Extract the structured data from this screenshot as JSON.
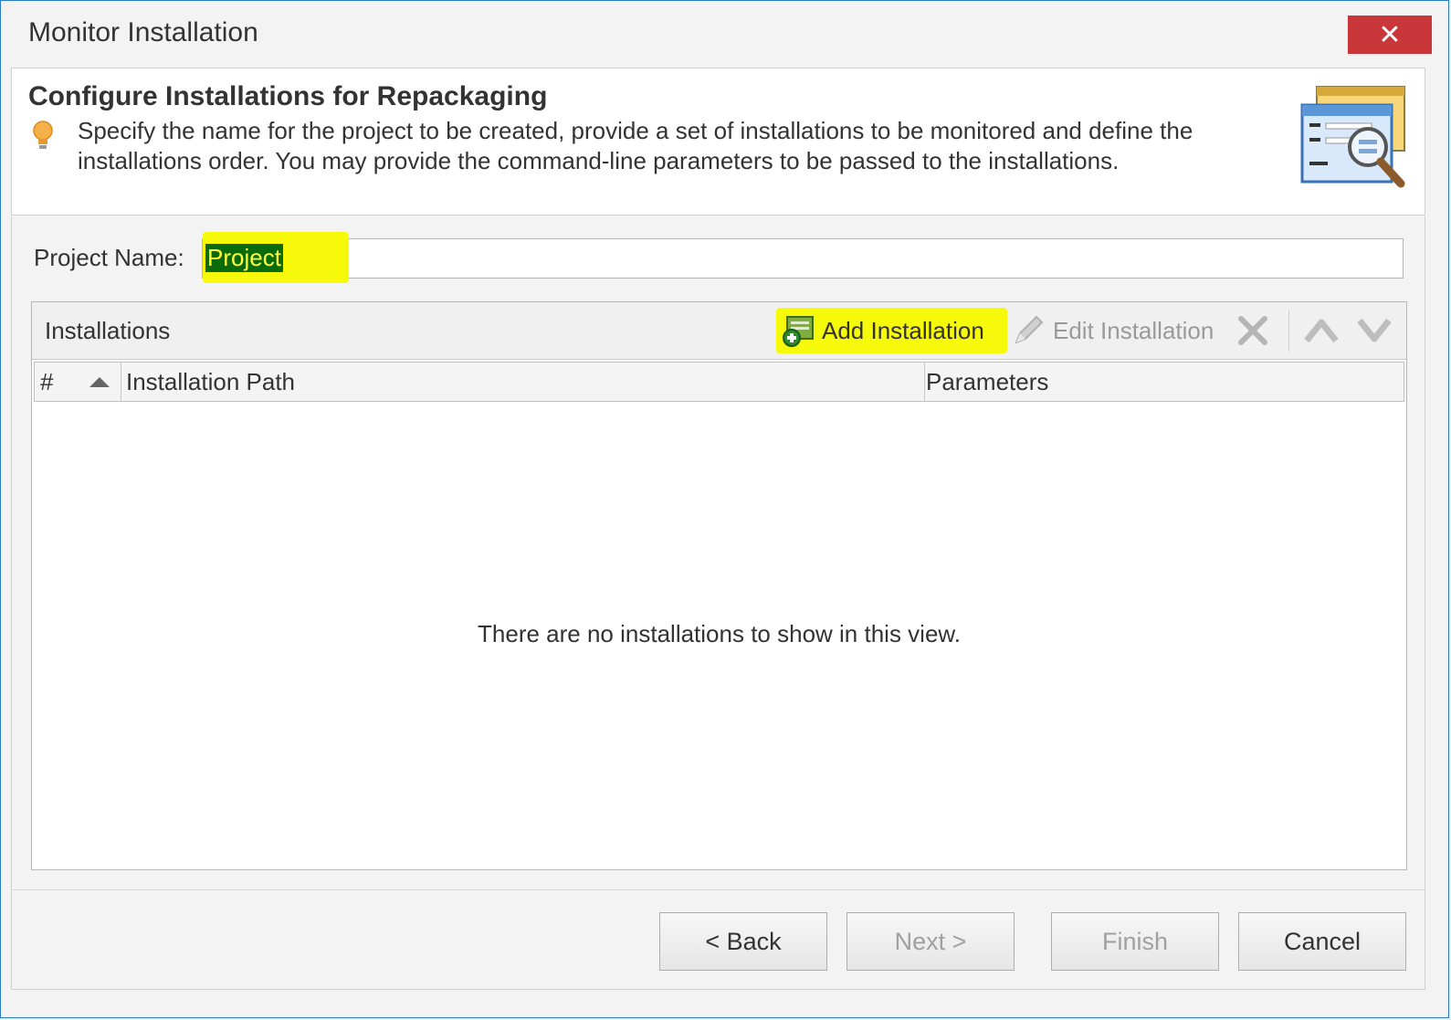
{
  "window": {
    "title": "Monitor Installation",
    "close_glyph": "✕"
  },
  "header": {
    "title": "Configure Installations for Repackaging",
    "description": "Specify the name for the project to be created, provide a set of installations to be monitored and define the installations order. You may provide the command-line parameters to be passed to the installations.",
    "hint_icon": "lightbulb-icon",
    "banner_icon": "installation-monitor-icon"
  },
  "project": {
    "label": "Project Name:",
    "value": "Project"
  },
  "installations": {
    "title": "Installations",
    "toolbar": {
      "add_label": "Add Installation",
      "edit_label": "Edit Installation",
      "delete_icon": "delete-icon",
      "move_up_icon": "move-up-icon",
      "move_down_icon": "move-down-icon"
    },
    "columns": {
      "number": "#",
      "path": "Installation Path",
      "parameters": "Parameters"
    },
    "rows": [],
    "empty_message": "There are no installations to show in this view."
  },
  "footer": {
    "back_label": "< Back",
    "next_label": "Next >",
    "finish_label": "Finish",
    "cancel_label": "Cancel"
  },
  "colors": {
    "highlight": "#f7f90a",
    "close_red": "#c9373a",
    "selection_bg": "#0a6b0a"
  }
}
